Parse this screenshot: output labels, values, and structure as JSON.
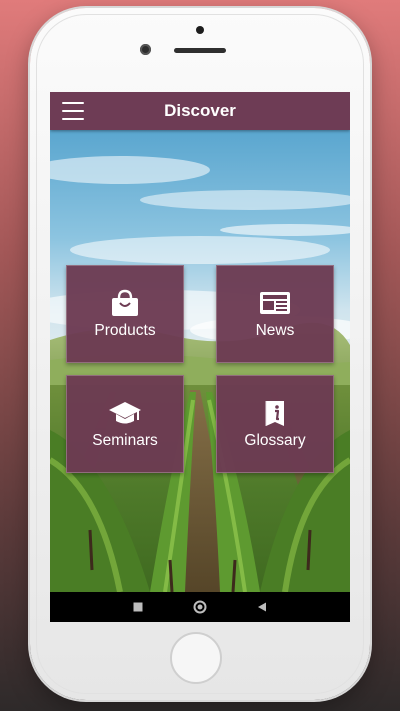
{
  "app_bar": {
    "title": "Discover",
    "menu_icon": "hamburger-menu-icon"
  },
  "tiles": [
    {
      "label": "Products",
      "icon": "shopping-bag-icon"
    },
    {
      "label": "News",
      "icon": "newspaper-icon"
    },
    {
      "label": "Seminars",
      "icon": "graduation-cap-icon"
    },
    {
      "label": "Glossary",
      "icon": "info-book-icon"
    }
  ],
  "nav_bar": {
    "buttons": [
      "recents-square-icon",
      "home-circle-icon",
      "back-triangle-icon"
    ]
  },
  "colors": {
    "primary": "#6e3c55",
    "tile_bg": "#6c3a52",
    "background_top": "#e07b7b",
    "background_bottom": "#2e2a2a"
  }
}
